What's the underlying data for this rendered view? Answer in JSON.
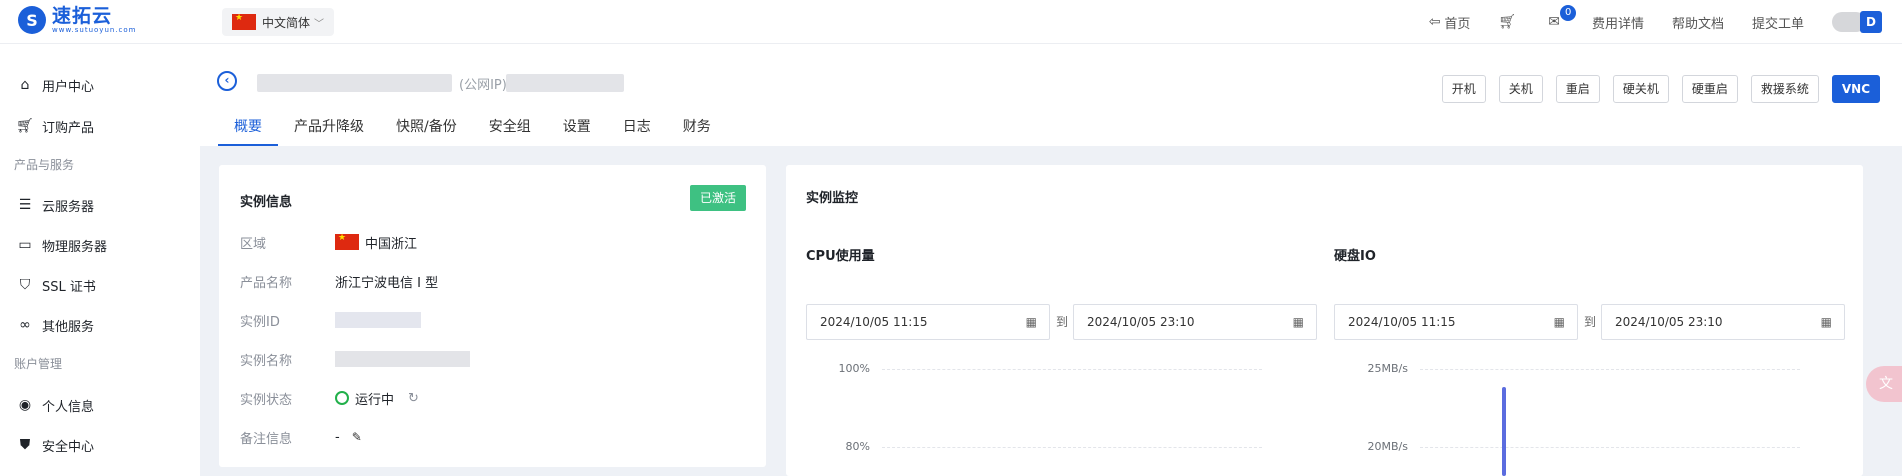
{
  "brand": {
    "mark": "S",
    "name": "速拓云",
    "tagline": "www.sutuoyun.com"
  },
  "language": {
    "label": "中文简体"
  },
  "topnav": {
    "home": "首页",
    "mail_count": "0",
    "billing": "费用详情",
    "docs": "帮助文档",
    "ticket": "提交工单",
    "avatar_initial": "D"
  },
  "sidebar": {
    "items_top": [
      {
        "label": "用户中心"
      },
      {
        "label": "订购产品"
      }
    ],
    "group_products": "产品与服务",
    "items_products": [
      {
        "label": "云服务器"
      },
      {
        "label": "物理服务器"
      },
      {
        "label": "SSL 证书"
      },
      {
        "label": "其他服务"
      }
    ],
    "group_account": "账户管理",
    "items_account": [
      {
        "label": "个人信息"
      },
      {
        "label": "安全中心"
      }
    ]
  },
  "header": {
    "ip_label": "(公网IP)",
    "actions": [
      "开机",
      "关机",
      "重启",
      "硬关机",
      "硬重启",
      "救援系统",
      "VNC"
    ],
    "tabs": [
      "概要",
      "产品升降级",
      "快照/备份",
      "安全组",
      "设置",
      "日志",
      "财务"
    ]
  },
  "instance_info": {
    "title": "实例信息",
    "status_tag": "已激活",
    "rows": {
      "region_label": "区域",
      "region_value": "中国浙江",
      "product_label": "产品名称",
      "product_value": "浙江宁波电信 I 型",
      "id_label": "实例ID",
      "name_label": "实例名称",
      "state_label": "实例状态",
      "state_value": "运行中",
      "note_label": "备注信息",
      "note_value": "-"
    }
  },
  "monitoring": {
    "title": "实例监控",
    "cpu": {
      "title": "CPU使用量",
      "start": "2024/10/05 11:15",
      "to": "到",
      "end": "2024/10/05 23:10",
      "y_ticks": [
        "100%",
        "80%"
      ]
    },
    "disk": {
      "title": "硬盘IO",
      "start": "2024/10/05 11:15",
      "to": "到",
      "end": "2024/10/05 23:10",
      "y_ticks": [
        "25MB/s",
        "20MB/s"
      ]
    }
  },
  "colors": {
    "primary": "#1b5fd9",
    "active_tag": "#3ec182",
    "running": "#22b04b",
    "chart_line": "#5b6cdf"
  },
  "icons": {
    "home": "home-icon",
    "cart": "cart-icon",
    "mail": "mail-icon",
    "back": "back-icon",
    "calendar": "calendar-icon",
    "refresh": "refresh-icon",
    "edit": "edit-icon",
    "translate": "translate-icon"
  }
}
